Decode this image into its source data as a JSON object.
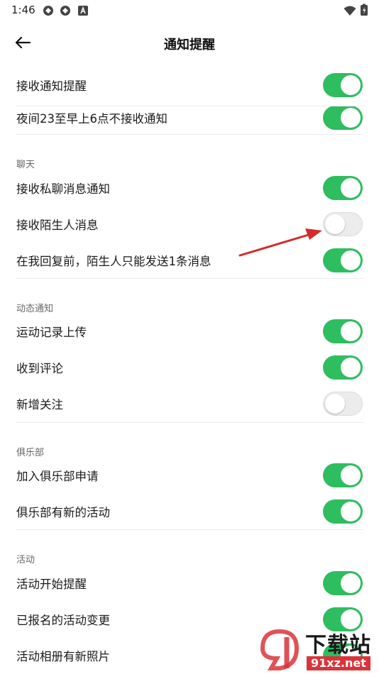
{
  "status_bar": {
    "time": "1:46"
  },
  "header": {
    "title": "通知提醒"
  },
  "rows": {
    "r1": {
      "label": "接收通知提醒",
      "on": true
    },
    "r2": {
      "label": "夜间23至早上6点不接收通知",
      "on": true
    },
    "r3": {
      "label": "接收私聊消息通知",
      "on": true
    },
    "r4": {
      "label": "接收陌生人消息",
      "on": false
    },
    "r5": {
      "label": "在我回复前，陌生人只能发送1条消息",
      "on": true
    },
    "r6": {
      "label": "运动记录上传",
      "on": true
    },
    "r7": {
      "label": "收到评论",
      "on": true
    },
    "r8": {
      "label": "新增关注",
      "on": false
    },
    "r9": {
      "label": "加入俱乐部申请",
      "on": true
    },
    "r10": {
      "label": "俱乐部有新的活动",
      "on": true
    },
    "r11": {
      "label": "活动开始提醒",
      "on": true
    },
    "r12": {
      "label": "已报名的活动变更",
      "on": true
    },
    "r13": {
      "label": "活动相册有新照片",
      "on": true
    }
  },
  "sections": {
    "chat": "聊天",
    "moments": "动态通知",
    "club": "俱乐部",
    "activity": "活动"
  },
  "watermark": {
    "brand": "下载站",
    "site": "91xz.net"
  },
  "colors": {
    "toggle_on": "#2ebd5f",
    "toggle_off": "#ececec",
    "annotation_arrow": "#d42a2a"
  }
}
